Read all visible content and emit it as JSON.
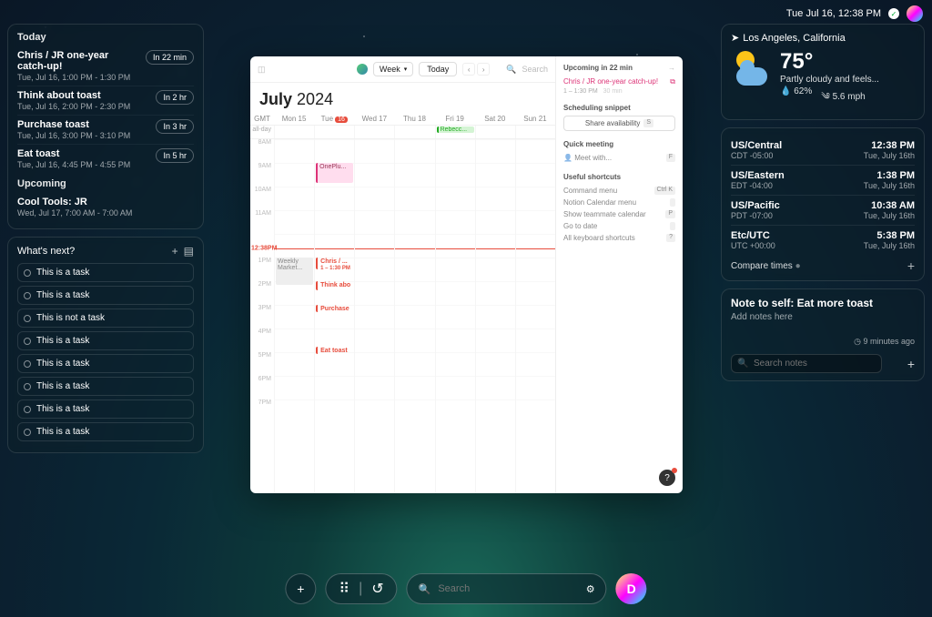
{
  "topbar": {
    "datetime": "Tue Jul 16,  12:38 PM"
  },
  "today": {
    "header": "Today",
    "events": [
      {
        "title": "Chris / JR one-year catch-up!",
        "time": "Tue, Jul 16, 1:00 PM - 1:30 PM",
        "pill": "In 22 min"
      },
      {
        "title": "Think about toast",
        "time": "Tue, Jul 16, 2:00 PM - 2:30 PM",
        "pill": "In 2 hr"
      },
      {
        "title": "Purchase toast",
        "time": "Tue, Jul 16, 3:00 PM - 3:10 PM",
        "pill": "In 3 hr"
      },
      {
        "title": "Eat toast",
        "time": "Tue, Jul 16, 4:45 PM - 4:55 PM",
        "pill": "In 5 hr"
      }
    ],
    "upcoming_header": "Upcoming",
    "upcoming": [
      {
        "title": "Cool Tools: JR",
        "time": "Wed, Jul 17, 7:00 AM - 7:00 AM"
      }
    ]
  },
  "tasks": {
    "header": "What's next?",
    "items": [
      "This is a task",
      "This is a task",
      "This is not a task",
      "This is a task",
      "This is a task",
      "This is a task",
      "This is a task",
      "This is a task"
    ]
  },
  "weather": {
    "location": "Los Angeles, California",
    "temp": "75°",
    "desc": "Partly cloudy and feels...",
    "humidity": "62%",
    "wind": "5.6 mph"
  },
  "timezones": {
    "rows": [
      {
        "name": "US/Central",
        "offset": "CDT -05:00",
        "time": "12:38 PM",
        "date": "Tue, July 16th"
      },
      {
        "name": "US/Eastern",
        "offset": "EDT -04:00",
        "time": "1:38 PM",
        "date": "Tue, July 16th"
      },
      {
        "name": "US/Pacific",
        "offset": "PDT -07:00",
        "time": "10:38 AM",
        "date": "Tue, July 16th"
      },
      {
        "name": "Etc/UTC",
        "offset": "UTC +00:00",
        "time": "5:38 PM",
        "date": "Tue, July 16th"
      }
    ],
    "compare": "Compare times"
  },
  "note": {
    "title": "Note to self: Eat more toast",
    "sub": "Add notes here",
    "meta": "9 minutes ago",
    "search_ph": "Search notes"
  },
  "calendar": {
    "month": "July",
    "year": "2024",
    "view_label": "Week",
    "today_label": "Today",
    "search_ph": "Search",
    "now_label": "12:38PM",
    "days": [
      "GMT",
      "Mon 15",
      "Tue",
      "Wed 17",
      "Thu 18",
      "Fri 19",
      "Sat 20",
      "Sun 21"
    ],
    "today_num": "16",
    "allday_label": "all-day",
    "allday_event": "Rebecc...",
    "hours": [
      "8AM",
      "9AM",
      "10AM",
      "11AM",
      "",
      "1PM",
      "2PM",
      "3PM",
      "4PM",
      "5PM",
      "6PM",
      "7PM"
    ],
    "ev_oneplus": "OnePlu...",
    "ev_chris_title": "Chris / ...",
    "ev_chris_time": "1 – 1:30 PM",
    "ev_think": "Think abo",
    "ev_purchase": "Purchase",
    "ev_eat": "Eat toast",
    "ev_weekly": "Weekly\nMarket...",
    "side": {
      "upcoming_hd": "Upcoming in 22 min",
      "upcoming_title": "Chris / JR one-year catch-up!",
      "upcoming_time": "1 – 1:30 PM",
      "upcoming_dur": "30 min",
      "snippet_hd": "Scheduling snippet",
      "share": "Share availability",
      "quick_hd": "Quick meeting",
      "quick_ph": "Meet with...",
      "shortcuts_hd": "Useful shortcuts",
      "shortcuts": [
        {
          "label": "Command menu",
          "key": "Ctrl K"
        },
        {
          "label": "Notion Calendar menu",
          "key": ""
        },
        {
          "label": "Show teammate calendar",
          "key": "P"
        },
        {
          "label": "Go to date",
          "key": ""
        },
        {
          "label": "All keyboard shortcuts",
          "key": "?"
        }
      ]
    }
  },
  "dock": {
    "search_ph": "Search",
    "avatar": "D"
  }
}
